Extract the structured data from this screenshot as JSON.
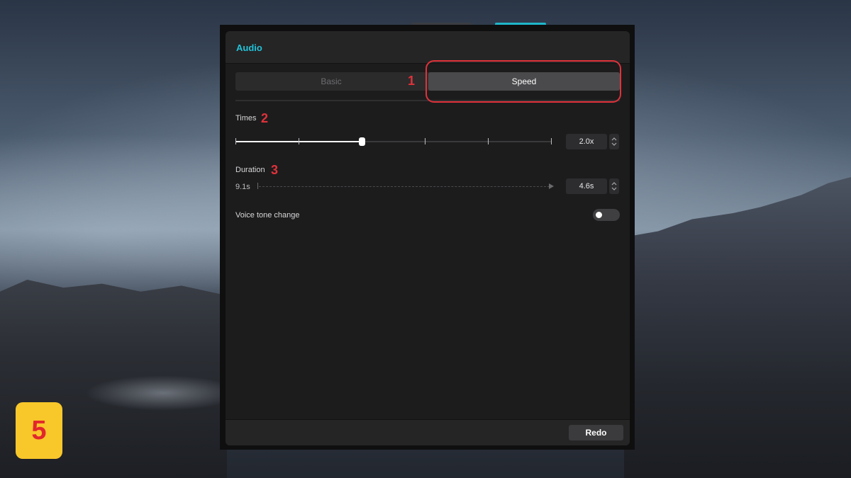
{
  "panel": {
    "title": "Audio",
    "tabs": [
      {
        "label": "Basic",
        "selected": false
      },
      {
        "label": "Speed",
        "selected": true
      }
    ],
    "times": {
      "label": "Times",
      "value": "2.0x",
      "slider_fraction": 0.4
    },
    "duration": {
      "label": "Duration",
      "original": "9.1s",
      "value": "4.6s"
    },
    "voice_tone": {
      "label": "Voice tone change",
      "enabled": false
    },
    "redo_label": "Redo"
  },
  "annotations": {
    "marker_1": "1",
    "marker_2": "2",
    "marker_3": "3",
    "color": "#e0323a"
  },
  "step_badge": "5",
  "colors": {
    "accent": "#22c2d8",
    "badge_bg": "#f8c72a",
    "badge_text": "#e2272d"
  }
}
